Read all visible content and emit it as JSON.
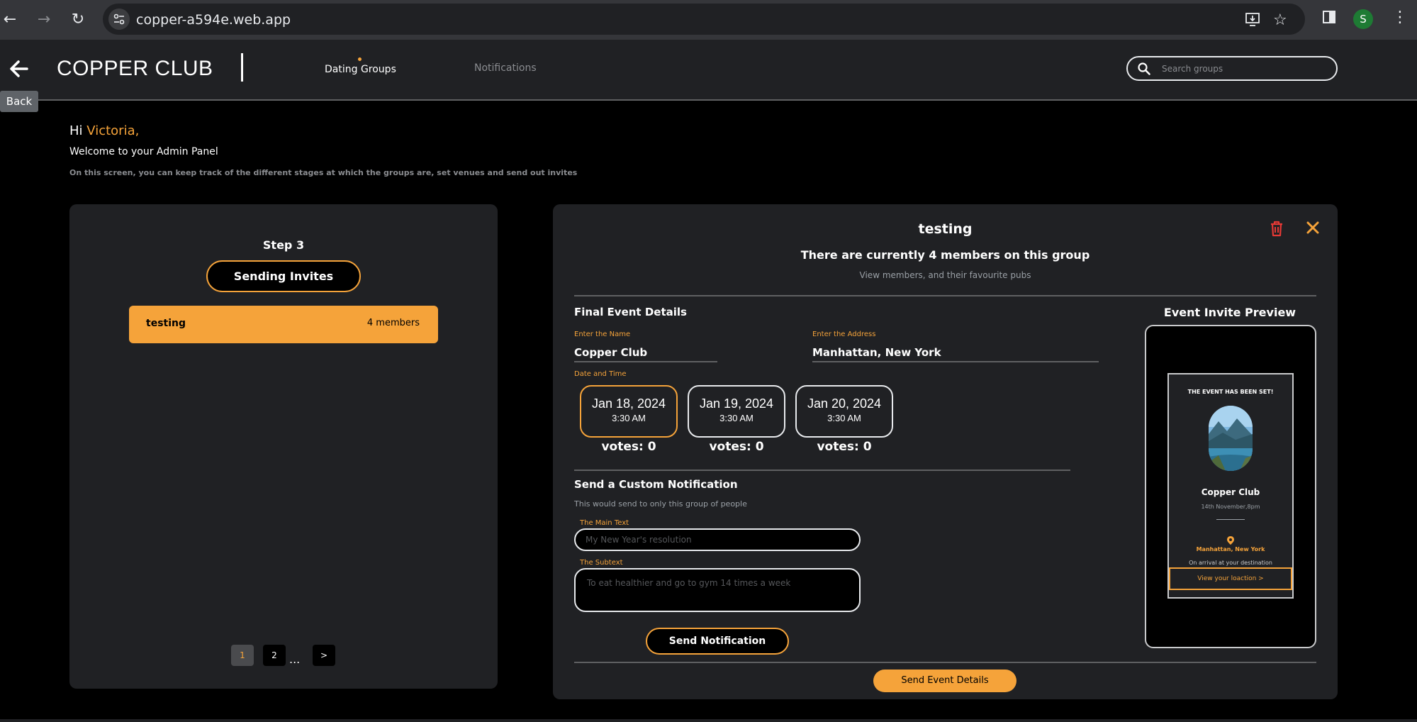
{
  "browser": {
    "url": "copper-a594e.web.app",
    "profile_initial": "S"
  },
  "header": {
    "brand": "COPPER CLUB",
    "nav": {
      "active": "Dating Groups",
      "inactive": "Notifications"
    },
    "search_placeholder": "Search groups",
    "back_tooltip": "Back"
  },
  "greeting": {
    "hi": "Hi",
    "name": "Victoria,",
    "welcome": "Welcome to your Admin Panel",
    "description": "On this screen, you can keep track of the different stages at which the groups are, set venues and send out invites"
  },
  "left_panel": {
    "step": "Step 3",
    "stage": "Sending Invites",
    "groups": [
      {
        "name": "testing",
        "members": "4 members"
      }
    ],
    "pagination": {
      "page1": "1",
      "page2": "2",
      "dots": "...",
      "next": ">"
    }
  },
  "right_panel": {
    "title": "testing",
    "members_line": "There are currently 4 members on this group",
    "members_sub": "View members, and their favourite pubs",
    "final_details_title": "Final Event Details",
    "name_label": "Enter the Name",
    "name_value": "Copper Club",
    "address_label": "Enter the Address",
    "address_value": "Manhattan, New York",
    "datetime_label": "Date and Time",
    "dates": [
      {
        "date": "Jan 18, 2024",
        "time": "3:30 AM",
        "votes": "votes: 0"
      },
      {
        "date": "Jan 19, 2024",
        "time": "3:30 AM",
        "votes": "votes: 0"
      },
      {
        "date": "Jan 20, 2024",
        "time": "3:30 AM",
        "votes": "votes: 0"
      }
    ],
    "custom_notif_title": "Send a Custom Notification",
    "custom_notif_help": "This would send to only this group of people",
    "main_text_label": "The Main Text",
    "main_text_placeholder": "My New Year's resolution",
    "subtext_label": "The Subtext",
    "subtext_placeholder": "To eat healthier and go to gym 14 times a week",
    "send_notification": "Send Notification",
    "send_event_details": "Send Event Details"
  },
  "preview": {
    "title": "Event Invite Preview",
    "heading": "THE EVENT HAS BEEN SET!",
    "venue": "Copper Club",
    "date": "14th November,8pm",
    "location": "Manhattan, New York",
    "arrival": "On arrival at your destination",
    "button": "View your loaction >"
  },
  "colors": {
    "accent": "#f5a33a",
    "panel": "#202124",
    "delete": "#e53935"
  }
}
